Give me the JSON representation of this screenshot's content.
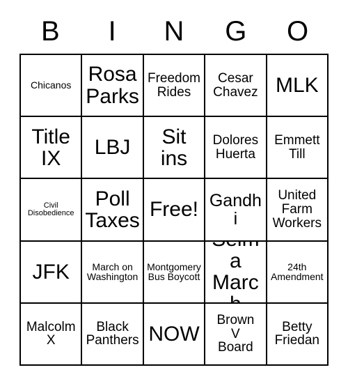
{
  "card": {
    "title_letters": [
      "B",
      "I",
      "N",
      "G",
      "O"
    ],
    "grid_columns": 5,
    "grid_rows": 5,
    "border_color": "#000000",
    "background_color": "#ffffff",
    "text_color": "#000000",
    "cells": [
      {
        "text": "Chicanos",
        "size": "size-sm",
        "row": 1,
        "col": 1,
        "free": false
      },
      {
        "text": "Rosa\nParks",
        "size": "size-xl",
        "row": 1,
        "col": 2,
        "free": false
      },
      {
        "text": "Freedom\nRides",
        "size": "size-md",
        "row": 1,
        "col": 3,
        "free": false
      },
      {
        "text": "Cesar\nChavez",
        "size": "size-md",
        "row": 1,
        "col": 4,
        "free": false
      },
      {
        "text": "MLK",
        "size": "size-xl",
        "row": 1,
        "col": 5,
        "free": false
      },
      {
        "text": "Title\nIX",
        "size": "size-xl",
        "row": 2,
        "col": 1,
        "free": false
      },
      {
        "text": "LBJ",
        "size": "size-xl",
        "row": 2,
        "col": 2,
        "free": false
      },
      {
        "text": "Sit\nins",
        "size": "size-xl",
        "row": 2,
        "col": 3,
        "free": false
      },
      {
        "text": "Dolores\nHuerta",
        "size": "size-md",
        "row": 2,
        "col": 4,
        "free": false
      },
      {
        "text": "Emmett\nTill",
        "size": "size-md",
        "row": 2,
        "col": 5,
        "free": false
      },
      {
        "text": "Civil\nDisobedience",
        "size": "size-xs",
        "row": 3,
        "col": 1,
        "free": false
      },
      {
        "text": "Poll\nTaxes",
        "size": "size-xl",
        "row": 3,
        "col": 2,
        "free": false
      },
      {
        "text": "Free!",
        "size": "size-xl",
        "row": 3,
        "col": 3,
        "free": true
      },
      {
        "text": "Gandhi",
        "size": "size-lg",
        "row": 3,
        "col": 4,
        "free": false
      },
      {
        "text": "United\nFarm\nWorkers",
        "size": "size-md",
        "row": 3,
        "col": 5,
        "free": false
      },
      {
        "text": "JFK",
        "size": "size-xl",
        "row": 4,
        "col": 1,
        "free": false
      },
      {
        "text": "March on\nWashington",
        "size": "size-sm",
        "row": 4,
        "col": 2,
        "free": false
      },
      {
        "text": "Montgomery\nBus Boycott",
        "size": "size-sm",
        "row": 4,
        "col": 3,
        "free": false
      },
      {
        "text": "Selma\nMarch",
        "size": "size-xl",
        "row": 4,
        "col": 4,
        "free": false
      },
      {
        "text": "24th\nAmendment",
        "size": "size-sm",
        "row": 4,
        "col": 5,
        "free": false
      },
      {
        "text": "Malcolm\nX",
        "size": "size-md",
        "row": 5,
        "col": 1,
        "free": false
      },
      {
        "text": "Black\nPanthers",
        "size": "size-md",
        "row": 5,
        "col": 2,
        "free": false
      },
      {
        "text": "NOW",
        "size": "size-xl",
        "row": 5,
        "col": 3,
        "free": false
      },
      {
        "text": "Brown\nV\nBoard",
        "size": "size-md",
        "row": 5,
        "col": 4,
        "free": false
      },
      {
        "text": "Betty\nFriedan",
        "size": "size-md",
        "row": 5,
        "col": 5,
        "free": false
      }
    ]
  }
}
